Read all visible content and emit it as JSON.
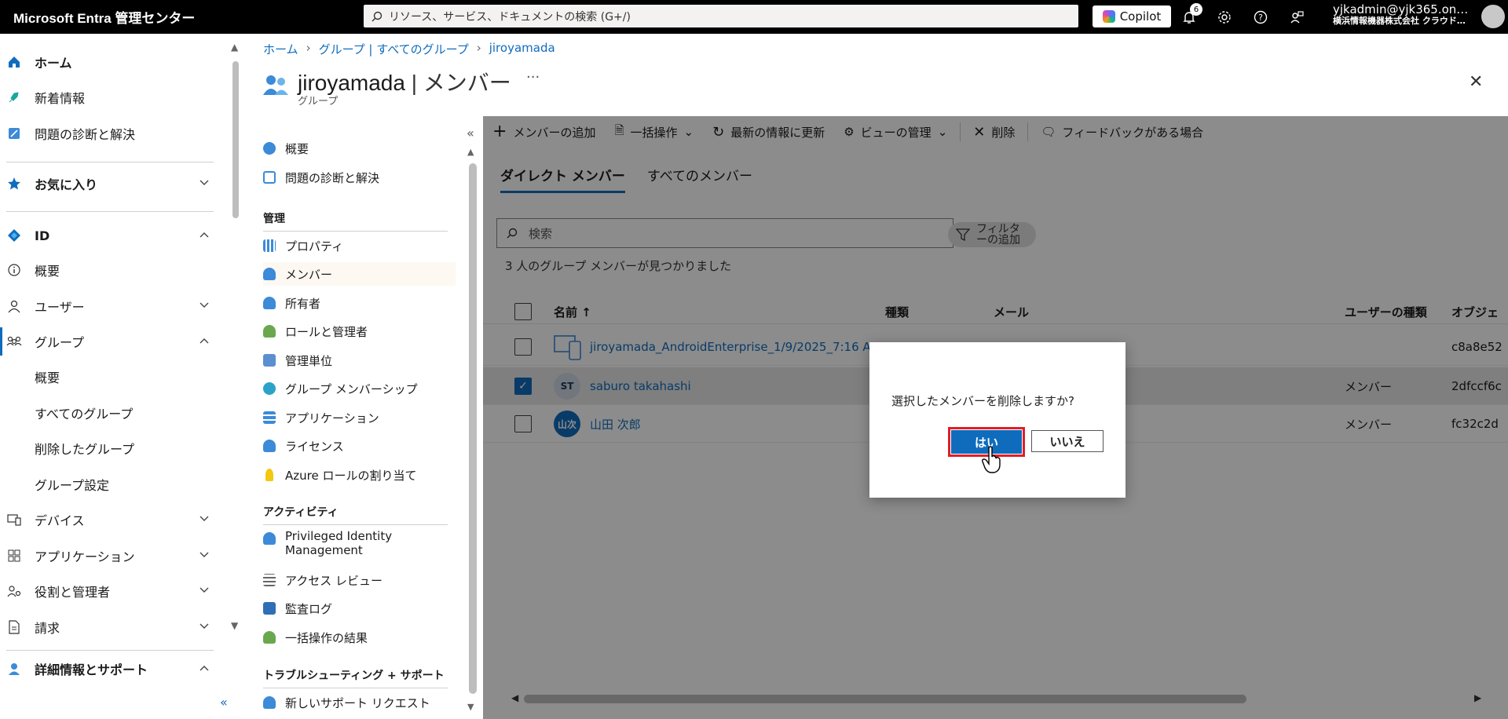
{
  "topbar": {
    "brand": "Microsoft Entra 管理センター",
    "search_placeholder": "リソース、サービス、ドキュメントの検索 (G+/)",
    "copilot_label": "Copilot",
    "notification_count": "6",
    "account_email": "yjkadmin@yjk365.on…",
    "account_tenant": "横浜情報機器株式会社 クラウド…"
  },
  "leftnav": {
    "home": "ホーム",
    "whats_new": "新着情報",
    "diagnose": "問題の診断と解決",
    "favorites": "お気に入り",
    "identity": "ID",
    "overview": "概要",
    "users": "ユーザー",
    "groups": "グループ",
    "groups_overview": "概要",
    "all_groups": "すべてのグループ",
    "deleted_groups": "削除したグループ",
    "group_settings": "グループ設定",
    "devices": "デバイス",
    "applications": "アプリケーション",
    "roles": "役割と管理者",
    "billing": "請求",
    "learn_support": "詳細情報とサポート"
  },
  "breadcrumb": {
    "home": "ホーム",
    "groups": "グループ | すべてのグループ",
    "current": "jiroyamada"
  },
  "header": {
    "title": "jiroyamada",
    "title_section": "| メンバー",
    "subtitle": "グループ"
  },
  "resmenu": {
    "overview": "概要",
    "diagnose": "問題の診断と解決",
    "manage_heading": "管理",
    "properties": "プロパティ",
    "members": "メンバー",
    "owners": "所有者",
    "roles_admins": "ロールと管理者",
    "admin_units": "管理単位",
    "group_memberships": "グループ メンバーシップ",
    "applications": "アプリケーション",
    "licenses": "ライセンス",
    "azure_roles": "Azure ロールの割り当て",
    "activity_heading": "アクティビティ",
    "pim": "Privileged Identity Management",
    "access_reviews": "アクセス レビュー",
    "audit_logs": "監査ログ",
    "bulk_results": "一括操作の結果",
    "troubleshoot_heading": "トラブルシューティング + サポート",
    "new_support": "新しいサポート リクエスト"
  },
  "cmdbar": {
    "add_members": "メンバーの追加",
    "bulk": "一括操作",
    "refresh": "最新の情報に更新",
    "manage_view": "ビューの管理",
    "delete": "削除",
    "feedback": "フィードバックがある場合"
  },
  "tabs": {
    "direct": "ダイレクト メンバー",
    "all": "すべてのメンバー"
  },
  "search_placeholder": "検索",
  "filter_label_1": "フィルタ",
  "filter_label_2": "ーの追加",
  "found_text": "3 人のグループ メンバーが見つかりました",
  "columns": {
    "name": "名前 ↑",
    "type": "種類",
    "mail": "メール",
    "user_type": "ユーザーの種類",
    "object_id": "オブジェ"
  },
  "rows": [
    {
      "name": "jiroyamada_AndroidEnterprise_1/9/2025_7:16 AM",
      "user_type": "",
      "object_id": "c8a8e52",
      "avatar": "",
      "selected": false
    },
    {
      "name": "saburo takahashi",
      "user_type": "メンバー",
      "object_id": "2dfccf6c",
      "avatar": "ST",
      "selected": true
    },
    {
      "name": "山田 次郎",
      "user_type": "メンバー",
      "object_id": "fc32c2d",
      "avatar": "山次",
      "selected": false
    }
  ],
  "dialog": {
    "message": "選択したメンバーを削除しますか?",
    "yes": "はい",
    "no": "いいえ"
  },
  "colors": {
    "accent": "#0f6cbd",
    "highlight": "#e01e28"
  }
}
